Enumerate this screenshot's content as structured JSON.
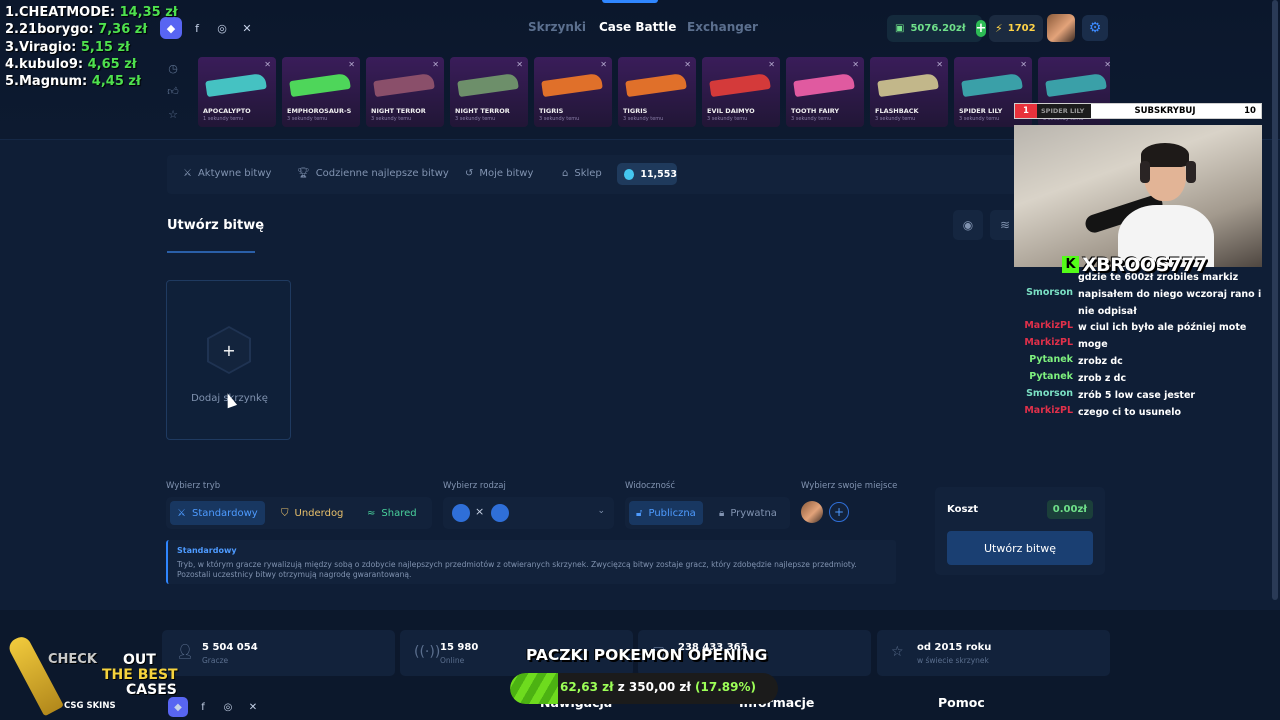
{
  "leaderboard": [
    {
      "rank": "1.",
      "name": "CHEATMODE:",
      "amount": "14,35 zł"
    },
    {
      "rank": "2.",
      "name": "21borygo:",
      "amount": "7,36 zł"
    },
    {
      "rank": "3.",
      "name": "Viragio:",
      "amount": "5,15 zł"
    },
    {
      "rank": "4.",
      "name": "kubulo9:",
      "amount": "4,65 zł"
    },
    {
      "rank": "5.",
      "name": "Magnum:",
      "amount": "4,45 zł"
    }
  ],
  "header": {
    "nav": {
      "skrzynki": "Skrzynki",
      "case_battle": "Case Battle",
      "exchanger": "Exchanger"
    },
    "balance": "5076.20zł",
    "deposit_symbol": "+",
    "coins": "1702"
  },
  "drops": [
    {
      "name": "APOCALYPTO",
      "sub": "1 sekundy temu",
      "color": "#45c2c2"
    },
    {
      "name": "EMPHOROSAUR-S",
      "sub": "3 sekundy temu",
      "color": "#4ed65a"
    },
    {
      "name": "NIGHT TERROR",
      "sub": "3 sekundy temu",
      "color": "#8a4f6a"
    },
    {
      "name": "NIGHT TERROR",
      "sub": "3 sekundy temu",
      "color": "#6d8f6a"
    },
    {
      "name": "TIGRIS",
      "sub": "3 sekundy temu",
      "color": "#e0702a"
    },
    {
      "name": "TIGRIS",
      "sub": "3 sekundy temu",
      "color": "#e0702a"
    },
    {
      "name": "EVIL DAIMYO",
      "sub": "3 sekundy temu",
      "color": "#d43a3a"
    },
    {
      "name": "TOOTH FAIRY",
      "sub": "3 sekundy temu",
      "color": "#e05aa0"
    },
    {
      "name": "FLASHBACK",
      "sub": "3 sekundy temu",
      "color": "#c2b78a"
    },
    {
      "name": "SPIDER LILY",
      "sub": "3 sekundy temu",
      "color": "#3aa0a8"
    },
    {
      "name": "SPIDER LILY",
      "sub": "3 sekundy temu",
      "color": "#3aa0a8"
    }
  ],
  "tabs": {
    "aktywne": "Aktywne bitwy",
    "codzienne": "Codzienne najlepsze bitwy",
    "moje": "Moje bitwy",
    "sklep": "Sklep",
    "gems": "11,553"
  },
  "create": {
    "title": "Utwórz bitwę",
    "add_case": "Dodaj skrzynkę",
    "add_symbol": "+"
  },
  "options": {
    "tryb_label": "Wybierz tryb",
    "modes": {
      "standard": "Standardowy",
      "underdog": "Underdog",
      "shared": "Shared"
    },
    "rodzaj_label": "Wybierz rodzaj",
    "vs": "×",
    "widocznosc_label": "Widoczność",
    "visibility": {
      "public": "Publiczna",
      "private": "Prywatna"
    },
    "miejsce_label": "Wybierz swoje miejsce",
    "seat_add": "+"
  },
  "cost": {
    "label": "Koszt",
    "value": "0.00zł",
    "button": "Utwórz bitwę"
  },
  "mode_description": {
    "title": "Standardowy",
    "text": "Tryb, w którym gracze rywalizują między sobą o zdobycie najlepszych przedmiotów z otwieranych skrzynek. Zwycięzcą bitwy zostaje gracz, który zdobędzie najlepsze przedmioty. Pozostali uczestnicy bitwy otrzymują nagrodę gwarantowaną."
  },
  "stats": [
    {
      "value": "5 504 054",
      "label": "Gracze"
    },
    {
      "value": "15 980",
      "label": "Online"
    },
    {
      "value": "238 433 365",
      "label": ""
    },
    {
      "value": "od 2015 roku",
      "label": "w świecie skrzynek"
    }
  ],
  "footer": {
    "nawigacja": "Nawigacja",
    "informacje": "Informacje",
    "pomoc": "Pomoc"
  },
  "stream": {
    "sub_count": "1",
    "sub_item": "SPIDER LILY",
    "sub_label": "SUBSKRYBUJ",
    "sub_goal": "10",
    "streamer": "XBROOS777",
    "kick_letter": "K",
    "chat": [
      {
        "user": "",
        "msg": "gdzie te 600zł zrobiles markiz",
        "color": "#ffffff"
      },
      {
        "user": "Smorson",
        "msg": "napisałem do niego wczoraj rano i nie odpisał",
        "color": "#7be0c4"
      },
      {
        "user": "MarkizPL",
        "msg": "w ciul ich było ale później mote",
        "color": "#e0304a"
      },
      {
        "user": "MarkizPL",
        "msg": "moge",
        "color": "#e0304a"
      },
      {
        "user": "Pytanek",
        "msg": "zrobz dc",
        "color": "#7ef07e"
      },
      {
        "user": "Pytanek",
        "msg": "zrob z dc",
        "color": "#7ef07e"
      },
      {
        "user": "Smorson",
        "msg": "zrób 5 low case jester",
        "color": "#7be0c4"
      },
      {
        "user": "MarkizPL",
        "msg": "czego ci to usunelo",
        "color": "#e0304a"
      }
    ],
    "banner": "PACZKI POKEMON OPENING",
    "goal_current": "62,63 zł",
    "goal_mid": " z ",
    "goal_target": "350,00 zł",
    "goal_percent": " (17.89%)",
    "goal_fraction": 0.1789,
    "promo": {
      "check": "CHECK",
      "out": "OUT",
      "best": "THE BEST",
      "cases": "CASES",
      "brand": "CSG SKINS"
    }
  }
}
